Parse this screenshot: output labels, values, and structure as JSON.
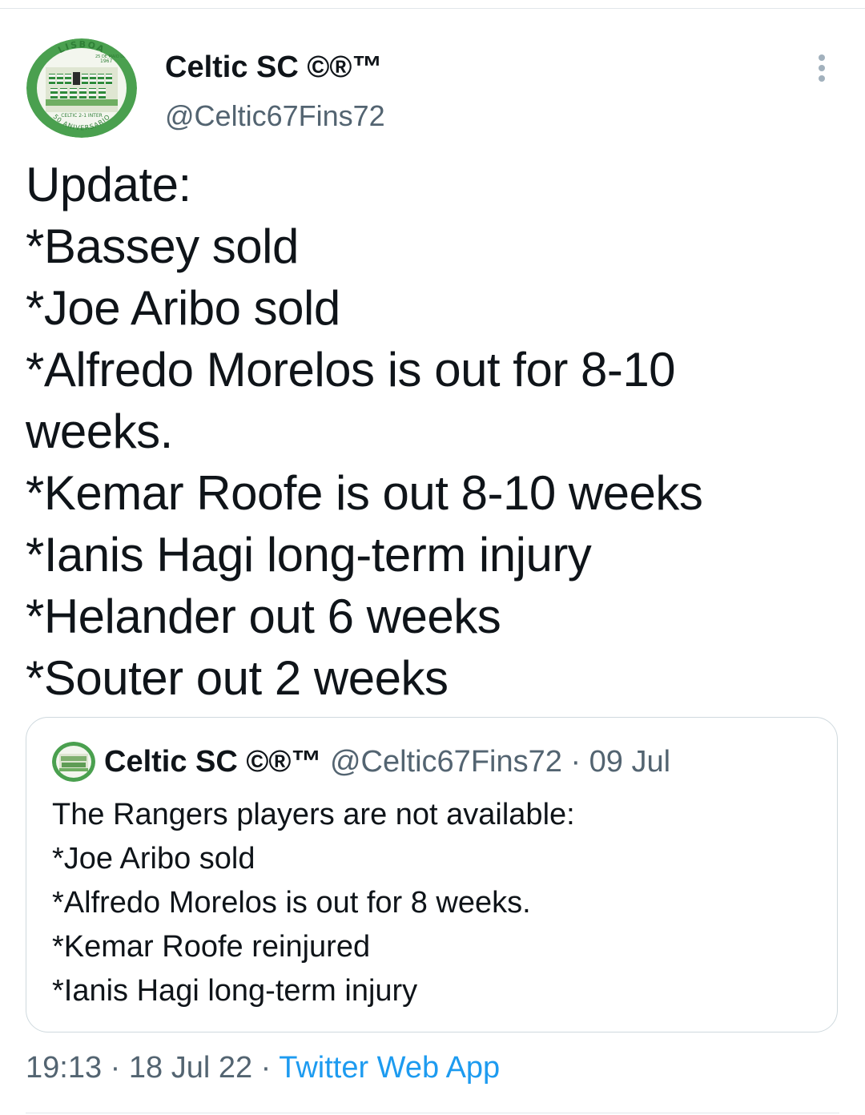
{
  "tweet": {
    "author_name": "Celtic SC ©®™",
    "author_handle": "@Celtic67Fins72",
    "avatar_icon": "team-photo-badge-avatar",
    "avatar_text": {
      "arc_top": "LISBOA",
      "date_line_1": "25 DE MAIO DE",
      "date_line_2": "1967",
      "score": "CELTIC 2-1 INTER",
      "arc_bottom": "50 ANIVERSARIO"
    },
    "text_lines": [
      "Update:",
      "*Bassey sold",
      "*Joe Aribo sold",
      "*Alfredo Morelos is out for 8-10",
      "weeks.",
      "*Kemar Roofe is out 8-10 weeks",
      "*Ianis Hagi long-term injury",
      "*Helander out 6 weeks",
      "*Souter out 2 weeks"
    ],
    "more_icon": "more-vertical-icon",
    "time": "19:13",
    "date": "18 Jul 22",
    "separator": "·",
    "source": "Twitter Web App"
  },
  "quote": {
    "author_name": "Celtic SC ©®™",
    "author_handle": "@Celtic67Fins72",
    "separator": "·",
    "date": "09 Jul",
    "text_lines": [
      "The Rangers players are not available:",
      "*Joe Aribo sold",
      "*Alfredo Morelos is out for 8 weeks.",
      "*Kemar Roofe reinjured",
      "*Ianis Hagi long-term injury"
    ]
  },
  "colors": {
    "text_primary": "#0f1419",
    "text_secondary": "#536471",
    "link": "#1d9bf0",
    "border": "#cfd9de",
    "avatar_green": "#3f9a45"
  }
}
